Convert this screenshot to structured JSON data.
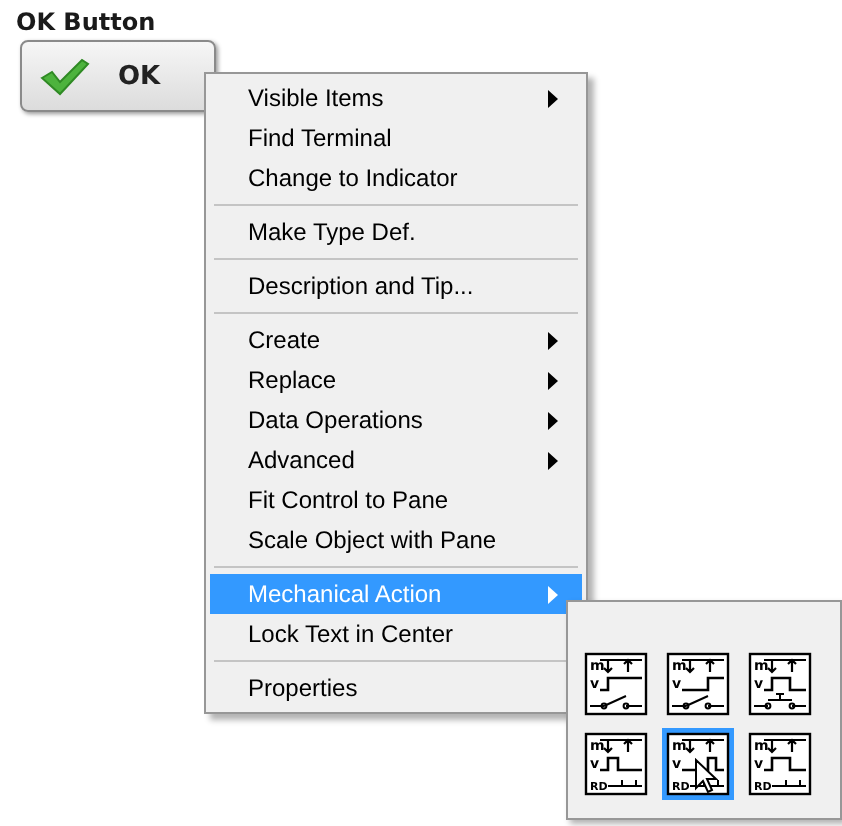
{
  "control": {
    "label": "OK Button",
    "button": "OK"
  },
  "menu": {
    "items": [
      {
        "kind": "item",
        "label": "Visible Items",
        "submenu": true,
        "selected": false
      },
      {
        "kind": "item",
        "label": "Find Terminal",
        "submenu": false,
        "selected": false
      },
      {
        "kind": "item",
        "label": "Change to Indicator",
        "submenu": false,
        "selected": false
      },
      {
        "kind": "separator"
      },
      {
        "kind": "item",
        "label": "Make Type Def.",
        "submenu": false,
        "selected": false
      },
      {
        "kind": "separator"
      },
      {
        "kind": "item",
        "label": "Description and Tip...",
        "submenu": false,
        "selected": false
      },
      {
        "kind": "separator"
      },
      {
        "kind": "item",
        "label": "Create",
        "submenu": true,
        "selected": false
      },
      {
        "kind": "item",
        "label": "Replace",
        "submenu": true,
        "selected": false
      },
      {
        "kind": "item",
        "label": "Data Operations",
        "submenu": true,
        "selected": false
      },
      {
        "kind": "item",
        "label": "Advanced",
        "submenu": true,
        "selected": false
      },
      {
        "kind": "item",
        "label": "Fit Control to Pane",
        "submenu": false,
        "selected": false
      },
      {
        "kind": "item",
        "label": "Scale Object with Pane",
        "submenu": false,
        "selected": false
      },
      {
        "kind": "separator"
      },
      {
        "kind": "item",
        "label": "Mechanical Action",
        "submenu": true,
        "selected": true
      },
      {
        "kind": "item",
        "label": "Lock Text in Center",
        "submenu": false,
        "selected": false
      },
      {
        "kind": "separator"
      },
      {
        "kind": "item",
        "label": "Properties",
        "submenu": false,
        "selected": false
      }
    ]
  },
  "mechanical_actions": [
    {
      "kind": "switch-press",
      "labels": [
        "m",
        "v"
      ],
      "selected": false
    },
    {
      "kind": "switch-release",
      "labels": [
        "m",
        "v"
      ],
      "selected": false
    },
    {
      "kind": "switch-until-release",
      "labels": [
        "m",
        "v"
      ],
      "selected": false
    },
    {
      "kind": "latch-press",
      "labels": [
        "m",
        "v",
        "RD"
      ],
      "selected": false
    },
    {
      "kind": "latch-release",
      "labels": [
        "m",
        "v",
        "RD"
      ],
      "selected": true
    },
    {
      "kind": "latch-until-release",
      "labels": [
        "m",
        "v",
        "RD"
      ],
      "selected": false
    }
  ]
}
